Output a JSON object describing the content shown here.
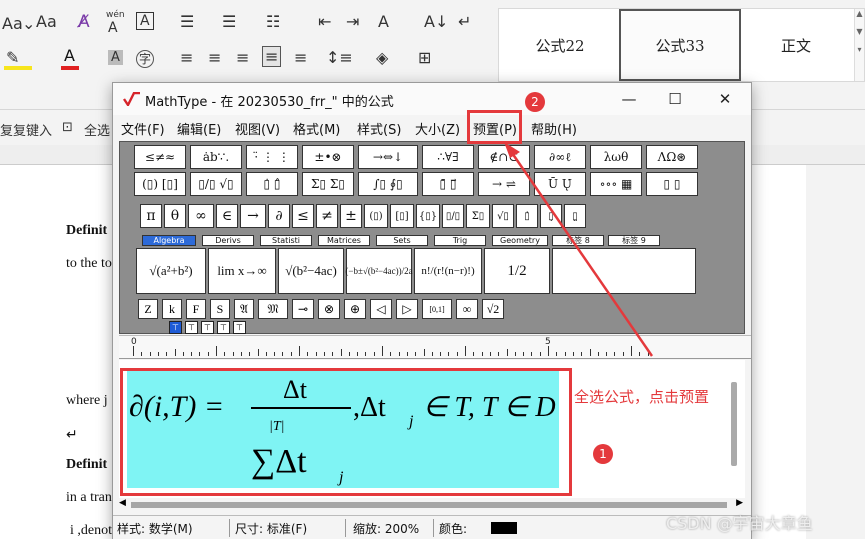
{
  "ribbon": {
    "font_size_label": "Aa",
    "wen_label": "wén",
    "a_label": "A",
    "zi_label": "字",
    "styles": [
      "公式22",
      "公式33",
      "正文"
    ]
  },
  "word": {
    "quick_type_label": "复复键入",
    "select_all_label": "全选",
    "doc_lines": [
      "Definit",
      "to the to",
      "where j",
      "Definit",
      "in a tran",
      "i ,denoted as"
    ]
  },
  "mathtype": {
    "title": "MathType - 在 20230530_frr_\" 中的公式",
    "menu": [
      "文件(F)",
      "编辑(E)",
      "视图(V)",
      "格式(M)",
      "样式(S)",
      "大小(Z)",
      "预置(P)",
      "帮助(H)"
    ],
    "palette_row1": [
      "≤≠≈",
      "ȧb∵.",
      "⋅̈ ⋮ ⋮",
      "±•⊗",
      "→⇔↓",
      "∴∀∃",
      "∉∩⊂",
      "∂∞ℓ",
      "λωθ",
      "ΛΩ⊛"
    ],
    "palette_row2": [
      "(▯) [▯]",
      "▯/▯ √▯",
      "▯̇ ▯̂",
      "Σ▯ Σ▯",
      "∫▯ ∮▯",
      "▯̄ ▯⃗",
      "→ ⇌",
      "Ū Ų̇",
      "∘∘∘ ▦",
      "▯ ▯"
    ],
    "palette_row3": [
      "π",
      "θ",
      "∞",
      "∈",
      "→",
      "∂",
      "≤",
      "≠",
      "±",
      "(▯)",
      "[▯]",
      "{▯}",
      "▯/▯",
      "Σ̇▯",
      "√▯",
      "▯̇",
      "▯̣",
      "▯̤"
    ],
    "tabs": [
      "Algebra",
      "Derivs",
      "Statisti",
      "Matrices",
      "Sets",
      "Trig",
      "Geometry",
      "标签 8",
      "标签 9"
    ],
    "templates": [
      "√(a²+b²)",
      "lim x→∞",
      "√(b²−4ac)",
      "(−b±√(b²−4ac))/2a",
      "n!/(r!(n−r)!)",
      "1/2"
    ],
    "palette_row5": [
      "Z",
      "k",
      "F",
      "S",
      "𝔄",
      "𝔐",
      "⊸",
      "⊗",
      "⊕",
      "◁",
      "▷",
      "[0,1]",
      "∞",
      "√2"
    ],
    "ruler_numbers": [
      "0",
      "5"
    ],
    "equation": {
      "lhs": "∂(i,T) =",
      "numerator": "Δt",
      "sum_top": "|T|",
      "sum_body": "∑Δt",
      "sub_j": "j",
      "rhs": ",Δt",
      "rhs_sub": "j",
      "rest": "∈ T, T ∈ D"
    },
    "status": {
      "style": "样式: 数学(M)",
      "size": "尺寸: 标准(F)",
      "zoom": "缩放: 200%",
      "color": "颜色:"
    }
  },
  "annotations": {
    "badge1": "1",
    "badge2": "2",
    "hint": "全选公式，点击预置"
  },
  "watermark": "CSDN @宇宙大章鱼",
  "colors": {
    "accent_red": "#e4393c",
    "equation_bg": "#7ff4f4",
    "active_tab": "#2d6ad8"
  }
}
